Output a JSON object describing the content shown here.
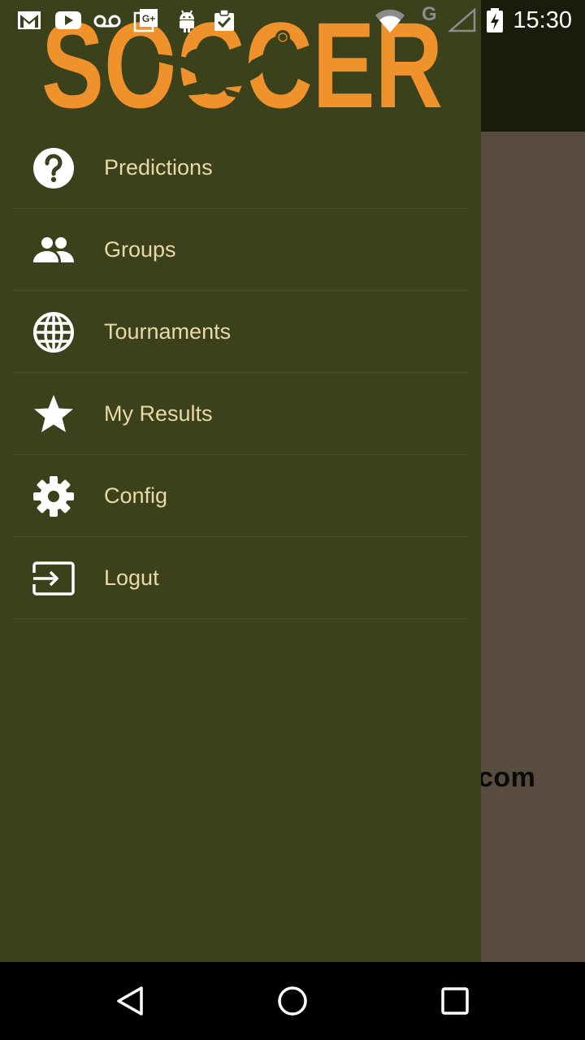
{
  "status_bar": {
    "time": "15:30",
    "network_label": "G",
    "left_icons": [
      "gmail-icon",
      "youtube-icon",
      "voicemail-icon",
      "google-plus-icon",
      "android-icon",
      "clipboard-check-icon"
    ],
    "right_icons": [
      "wifi-icon",
      "cell-signal-icon",
      "battery-charging-icon"
    ]
  },
  "drawer": {
    "logo_text": "SOCCER",
    "items": [
      {
        "label": "Predictions",
        "icon": "help-circle-icon"
      },
      {
        "label": "Groups",
        "icon": "people-icon"
      },
      {
        "label": "Tournaments",
        "icon": "globe-icon"
      },
      {
        "label": "My Results",
        "icon": "star-icon"
      },
      {
        "label": "Config",
        "icon": "gear-icon"
      },
      {
        "label": "Logut",
        "icon": "logout-icon"
      }
    ]
  },
  "background_app": {
    "partial_text": "com"
  },
  "colors": {
    "drawer_bg": "#3a411b",
    "label_color": "#e8d9a6",
    "logo_orange": "#f0922b",
    "toolbar_bg": "#181c0b",
    "content_bg": "#574c3e"
  }
}
